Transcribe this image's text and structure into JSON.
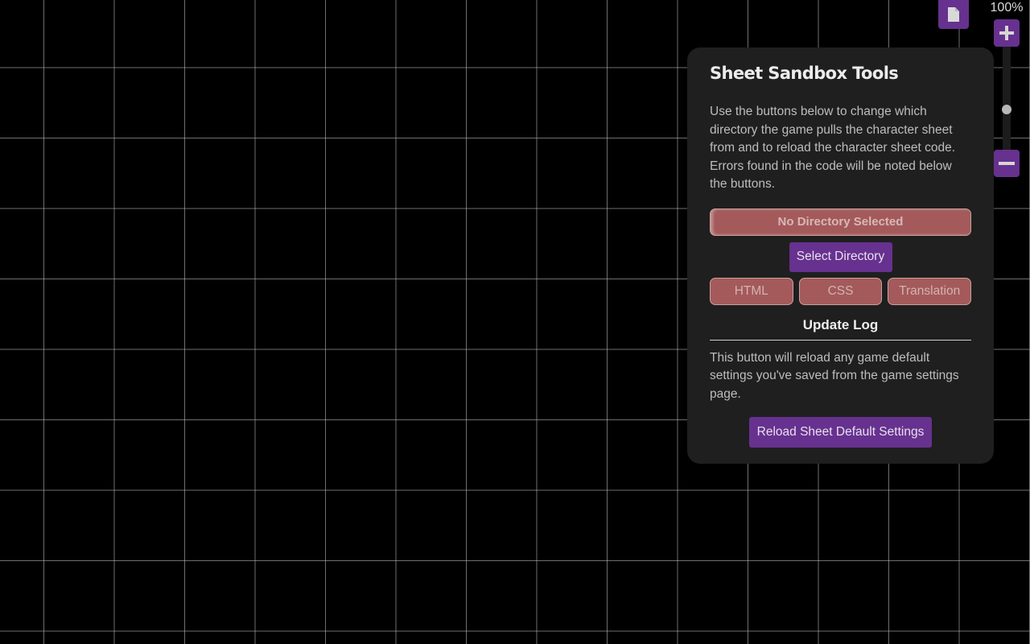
{
  "toolbar": {
    "document_icon": "document-icon",
    "zoom_level_label": "100%",
    "zoom_level_percent": 100,
    "zoom_in_icon": "plus-icon",
    "zoom_out_icon": "minus-icon",
    "zoom_slider_fraction": 0.38
  },
  "panel": {
    "title": "Sheet Sandbox Tools",
    "description": "Use the buttons below to change which directory the game pulls the character sheet from and to reload the character sheet code. Errors found in the code will be noted below the buttons.",
    "directory_status": "No Directory Selected",
    "select_directory_label": "Select Directory",
    "file_buttons": [
      {
        "label": "HTML"
      },
      {
        "label": "CSS"
      },
      {
        "label": "Translation"
      }
    ],
    "update_log_heading": "Update Log",
    "reload_description": "This button will reload any game default settings you've saved from the game settings page.",
    "reload_button_label": "Reload Sheet Default Settings"
  },
  "colors": {
    "accent_purple": "#67318f",
    "error_red": "#a45a5a",
    "panel_bg": "#1f1f1f",
    "canvas_bg": "#000000"
  }
}
